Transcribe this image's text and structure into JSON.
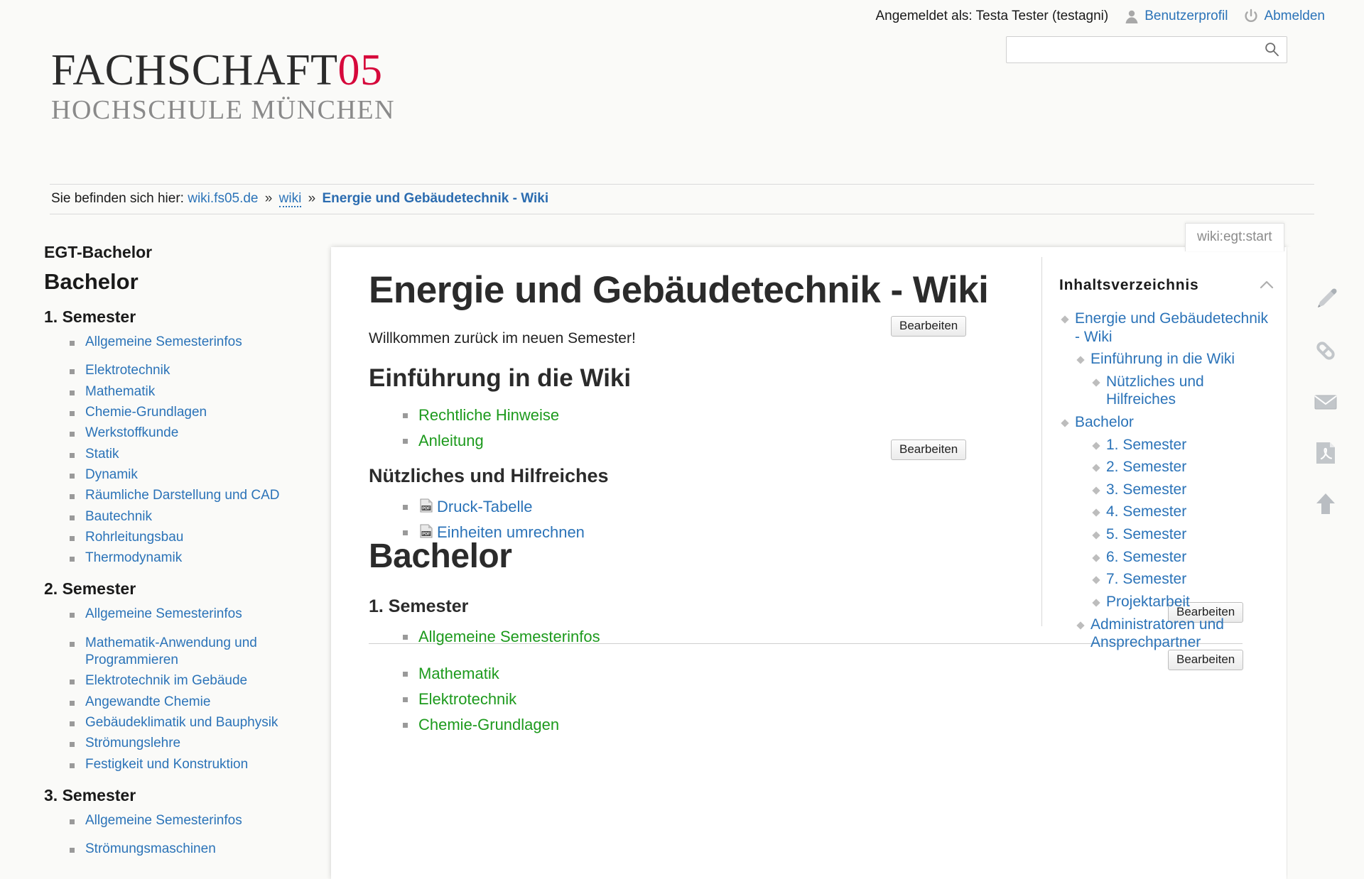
{
  "header": {
    "logged_in_text": "Angemeldet als: Testa Tester (testagni)",
    "profile_label": "Benutzerprofil",
    "logout_label": "Abmelden",
    "profile_icon": "user-icon",
    "logout_icon": "power-icon"
  },
  "search": {
    "value": "",
    "placeholder": "",
    "icon": "search-icon"
  },
  "logo": {
    "line1_text": "FACHSCHAFT",
    "line1_number": "05",
    "line2": "HOCHSCHULE MÜNCHEN",
    "accent_color": "#d6083b"
  },
  "breadcrumb": {
    "lead": "Sie befinden sich hier:",
    "items": [
      {
        "label": "wiki.fs05.de",
        "style": "link"
      },
      {
        "label": "wiki",
        "style": "link-dotted"
      },
      {
        "label": "Energie und Gebäudetechnik  -  Wiki",
        "style": "current"
      }
    ],
    "separator": "»"
  },
  "page_id": {
    "label": "wiki:egt:start"
  },
  "sidebar": {
    "title": "EGT-Bachelor",
    "heading": "Bachelor",
    "sections": [
      {
        "heading": "1. Semester",
        "items": [
          {
            "label": "Allgemeine Semesterinfos",
            "gap": true
          },
          {
            "label": "Elektrotechnik"
          },
          {
            "label": "Mathematik"
          },
          {
            "label": "Chemie-Grundlagen"
          },
          {
            "label": "Werkstoffkunde"
          },
          {
            "label": "Statik"
          },
          {
            "label": "Dynamik"
          },
          {
            "label": "Räumliche Darstellung und CAD"
          },
          {
            "label": "Bautechnik"
          },
          {
            "label": "Rohrleitungsbau"
          },
          {
            "label": "Thermodynamik"
          }
        ]
      },
      {
        "heading": "2. Semester",
        "items": [
          {
            "label": "Allgemeine Semesterinfos",
            "gap": true
          },
          {
            "label": "Mathematik-Anwendung und Programmieren"
          },
          {
            "label": "Elektrotechnik im Gebäude"
          },
          {
            "label": "Angewandte Chemie"
          },
          {
            "label": "Gebäudeklimatik und Bauphysik"
          },
          {
            "label": "Strömungslehre"
          },
          {
            "label": "Festigkeit und Konstruktion"
          }
        ]
      },
      {
        "heading": "3. Semester",
        "items": [
          {
            "label": "Allgemeine Semesterinfos",
            "gap": true
          },
          {
            "label": "Strömungsmaschinen"
          }
        ]
      }
    ]
  },
  "content": {
    "title": "Energie und Gebäudetechnik - Wiki",
    "intro": "Willkommen zurück im neuen Semester!",
    "section_intro_heading": "Einführung in die Wiki",
    "intro_links": [
      {
        "label": "Rechtliche Hinweise"
      },
      {
        "label": "Anleitung"
      }
    ],
    "section_useful_heading": "Nützliches und Hilfreiches",
    "useful_links": [
      {
        "label": "Druck-Tabelle",
        "icon": "pdf-icon"
      },
      {
        "label": "Einheiten umrechnen",
        "icon": "pdf-icon"
      }
    ],
    "bachelor_heading": "Bachelor",
    "bachelor_semester_heading": "1. Semester",
    "bachelor_links": [
      {
        "label": "Allgemeine Semesterinfos",
        "gap": true
      },
      {
        "label": "Mathematik"
      },
      {
        "label": "Elektrotechnik"
      },
      {
        "label": "Chemie-Grundlagen"
      }
    ],
    "edit_button_label": "Bearbeiten",
    "wikilink_color": "#1d9a1d",
    "medialink_color": "#2b73b8"
  },
  "toc": {
    "title": "Inhaltsverzeichnis",
    "toggle_icon": "chevron-up-icon",
    "items": [
      {
        "label": "Energie und Gebäudetechnik - Wiki",
        "level": 1
      },
      {
        "label": "Einführung in die Wiki",
        "level": 2
      },
      {
        "label": "Nützliches und Hilfreiches",
        "level": 3
      },
      {
        "label": "Bachelor",
        "level": 1
      },
      {
        "label": "1. Semester",
        "level": 3
      },
      {
        "label": "2. Semester",
        "level": 3
      },
      {
        "label": "3. Semester",
        "level": 3
      },
      {
        "label": "4. Semester",
        "level": 3
      },
      {
        "label": "5. Semester",
        "level": 3
      },
      {
        "label": "6. Semester",
        "level": 3
      },
      {
        "label": "7. Semester",
        "level": 3
      },
      {
        "label": "Projektarbeit",
        "level": 3
      },
      {
        "label": "Administratoren und Ansprechpartner",
        "level": 2
      }
    ]
  },
  "tools": {
    "items": [
      {
        "icon": "pencil-edit-icon",
        "name": "edit-page"
      },
      {
        "icon": "chain-link-icon",
        "name": "backlinks"
      },
      {
        "icon": "envelope-icon",
        "name": "send-email"
      },
      {
        "icon": "pdf-export-icon",
        "name": "export-pdf"
      },
      {
        "icon": "arrow-up-icon",
        "name": "back-to-top"
      }
    ]
  }
}
